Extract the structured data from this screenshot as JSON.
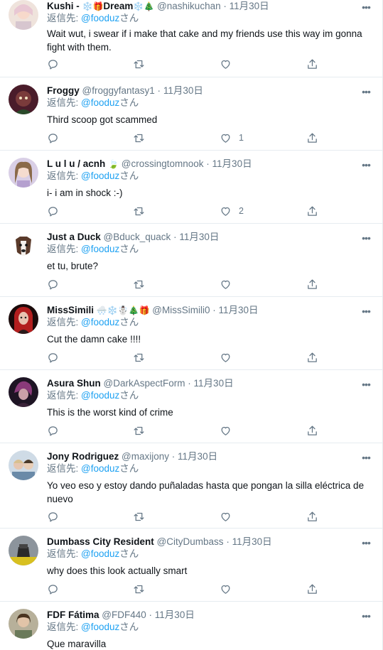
{
  "reply_prefix": "返信先:",
  "reply_suffix": "さん",
  "tweets": [
    {
      "name": "Kushi - ",
      "name_emoji": "❄️🎁",
      "name_2": "Dream",
      "name_emoji_2": "❄️🎄",
      "handle": "@nashikuchan",
      "time": "11月30日",
      "reply_to": "@fooduz",
      "text": "Wait wut, i swear if i make that cake and my friends use this way im gonna fight with them.",
      "likes": "",
      "avatar_color": "#e9d8d3"
    },
    {
      "name": "Froggy",
      "name_emoji": "",
      "handle": "@froggyfantasy1",
      "time": "11月30日",
      "reply_to": "@fooduz",
      "text": "Third scoop got scammed",
      "likes": "1",
      "avatar_color": "#6b2a3a"
    },
    {
      "name": "L u l u / acnh",
      "name_emoji": "🍃",
      "handle": "@crossingtomnook",
      "time": "11月30日",
      "reply_to": "@fooduz",
      "text": "i- i am in shock :-)",
      "likes": "2",
      "avatar_color": "#b9a6c9"
    },
    {
      "name": "Just a Duck",
      "name_emoji": "",
      "handle": "@Bduck_quack",
      "time": "11月30日",
      "reply_to": "@fooduz",
      "text": "et tu, brute?",
      "likes": "",
      "avatar_color": "#f2ede8"
    },
    {
      "name": "MissSimili",
      "name_emoji": "🌨️❄️☃️🎄🎁",
      "handle": "@MissSimili0",
      "time": "11月30日",
      "reply_to": "@fooduz",
      "text": "Cut the damn cake !!!!",
      "likes": "",
      "avatar_color": "#3a1414"
    },
    {
      "name": "Asura Shun",
      "name_emoji": "",
      "handle": "@DarkAspectForm",
      "time": "11月30日",
      "reply_to": "@fooduz",
      "text": "This is the worst kind of crime",
      "likes": "",
      "avatar_color": "#2b1a2e"
    },
    {
      "name": "Jony Rodriguez",
      "name_emoji": "",
      "handle": "@maxijony",
      "time": "11月30日",
      "reply_to": "@fooduz",
      "text": "Yo veo eso y estoy dando puñaladas hasta que pongan la silla eléctrica de nuevo",
      "likes": "",
      "avatar_color": "#b7c7d6"
    },
    {
      "name": "Dumbass City Resident",
      "name_emoji": "",
      "handle": "@CityDumbass",
      "time": "11月30日",
      "reply_to": "@fooduz",
      "text": "why does this look actually smart",
      "likes": "",
      "avatar_color": "#9aa0a6"
    },
    {
      "name": "FDF Fátima",
      "name_emoji": "",
      "handle": "@FDF440",
      "time": "11月30日",
      "reply_to": "@fooduz",
      "text": "Que maravilla",
      "likes": "",
      "avatar_color": "#a89a80"
    }
  ]
}
